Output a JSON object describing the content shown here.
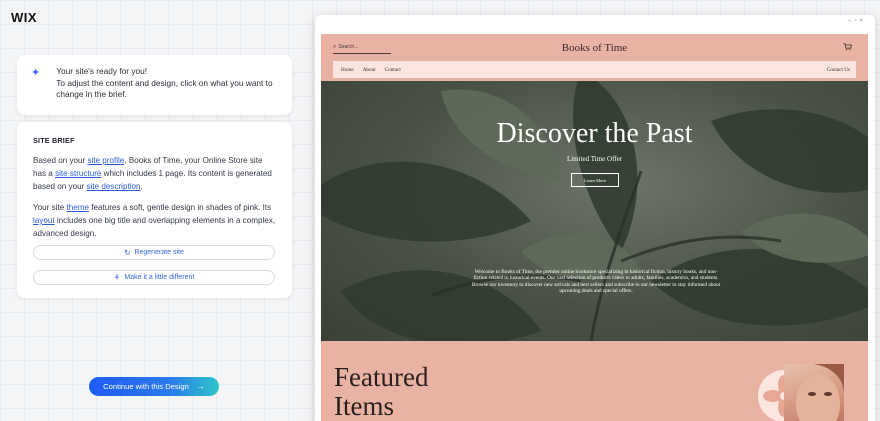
{
  "brand": {
    "logo": "WIX"
  },
  "ready_card": {
    "title": "Your site's ready for you!",
    "body": "To adjust the content and design, click on what you want to change in the brief."
  },
  "brief": {
    "heading": "SITE BRIEF",
    "p1": {
      "t1": "Based on your ",
      "link1": "site profile",
      "t2": ", Books of Time, your Online Store site has a ",
      "link2": "site structure",
      "t3": " which includes 1 page. Its content is generated based on your ",
      "link3": "site description",
      "t4": "."
    },
    "p2": {
      "t1": "Your site ",
      "link1": "theme",
      "t2": " features a soft, gentle design in shades of pink. Its ",
      "link2": "layout",
      "t3": " includes one big title and overlapping elements in a complex, advanced design."
    },
    "regenerate_label": "Regenerate site",
    "different_label": "Make it a little different"
  },
  "continue_label": "Continue with this Design",
  "preview": {
    "search_placeholder": "Search...",
    "site_title": "Books of Time",
    "nav": [
      "Home",
      "About",
      "Contact"
    ],
    "nav_right": "Contact Us",
    "hero_title": "Discover the Past",
    "hero_subtitle": "Limited Time Offer",
    "hero_button": "Learn More",
    "hero_description": "Welcome to Books of Time, the premier online bookstore specializing in historical fiction, history books, and non-fiction related to historical events. Our vast selection of products caters to adults, families, academics, and students. Browse our inventory to discover new arrivals and best sellers and subscribe to our newsletter to stay informed about upcoming deals and special offers.",
    "featured_line1": "Featured",
    "featured_line2": "Items"
  },
  "colors": {
    "accent": "#2d5bd7",
    "site_pink": "#e9b3a3",
    "nav_pink": "#fbe6df"
  }
}
